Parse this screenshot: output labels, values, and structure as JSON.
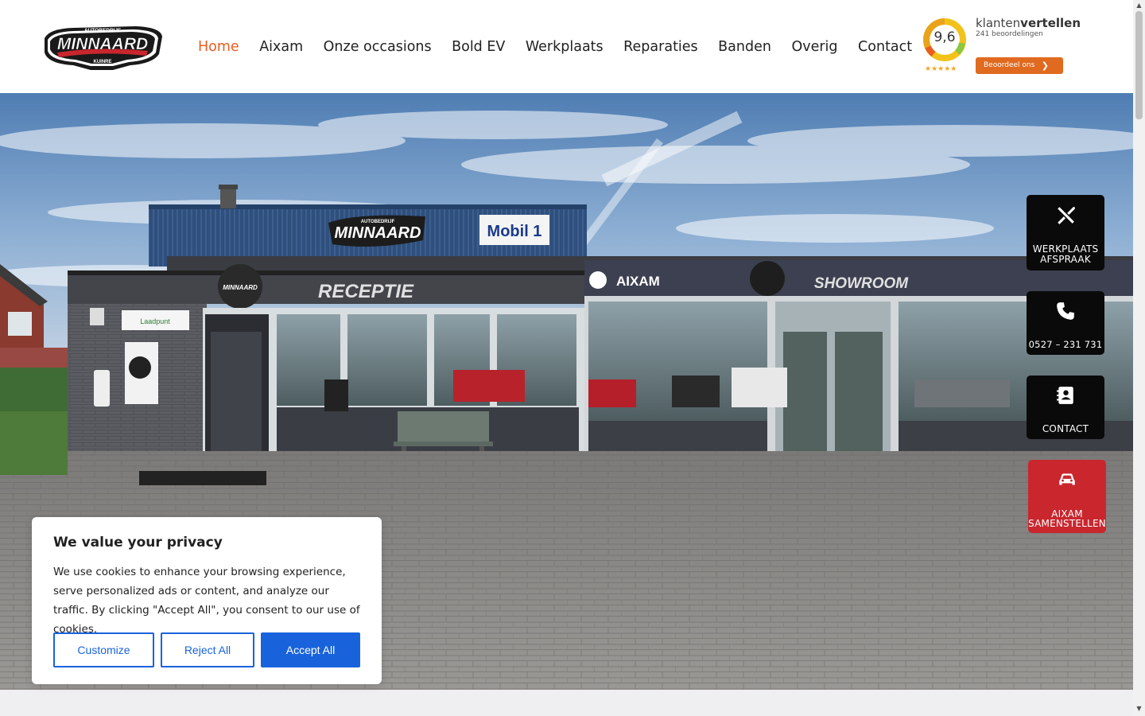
{
  "logo": {
    "top_text": "AUTOBEDRIJF",
    "main_text": "MINNAARD",
    "sub_text": "KUINRE"
  },
  "nav": {
    "items": [
      {
        "label": "Home",
        "active": true
      },
      {
        "label": "Aixam",
        "active": false
      },
      {
        "label": "Onze occasions",
        "active": false
      },
      {
        "label": "Bold EV",
        "active": false
      },
      {
        "label": "Werkplaats",
        "active": false
      },
      {
        "label": "Reparaties",
        "active": false
      },
      {
        "label": "Banden",
        "active": false
      },
      {
        "label": "Overig",
        "active": false
      },
      {
        "label": "Contact",
        "active": false
      }
    ],
    "active_color": "#e85d1e"
  },
  "klantenvertellen": {
    "score": "9,6",
    "brand_light": "klanten",
    "brand_bold": "vertellen",
    "reviews": "241 beoordelingen",
    "stars": "★★★★★",
    "button_label": "Beoordeel ons",
    "button_color": "#e06a1f"
  },
  "hero": {
    "signs": {
      "building_logo": "MINNAARD",
      "building_logo_top": "AUTOBEDRIJF",
      "building_logo_sub": "KUINRE",
      "mobil": "Mobil 1",
      "receptie": "RECEPTIE",
      "aixam": "AIXAM",
      "showroom": "SHOWROOM",
      "laadpunt": "Laadpunt"
    }
  },
  "side_buttons": {
    "werkplaats": {
      "line1": "WERKPLAATS",
      "line2": "AFSPRAAK",
      "icon": "tools-icon"
    },
    "phone": {
      "label": "0527 – 231 731",
      "icon": "phone-icon"
    },
    "contact": {
      "label": "CONTACT",
      "icon": "contact-card-icon"
    },
    "aixam": {
      "line1": "AIXAM",
      "line2": "SAMENSTELLEN",
      "icon": "car-icon",
      "color": "#c9262e"
    }
  },
  "cookie": {
    "title": "We value your privacy",
    "text": "We use cookies to enhance your browsing experience, serve personalized ads or content, and analyze our traffic. By clicking \"Accept All\", you consent to our use of cookies.",
    "customize": "Customize",
    "reject": "Reject All",
    "accept": "Accept All",
    "accent": "#1863dc"
  }
}
